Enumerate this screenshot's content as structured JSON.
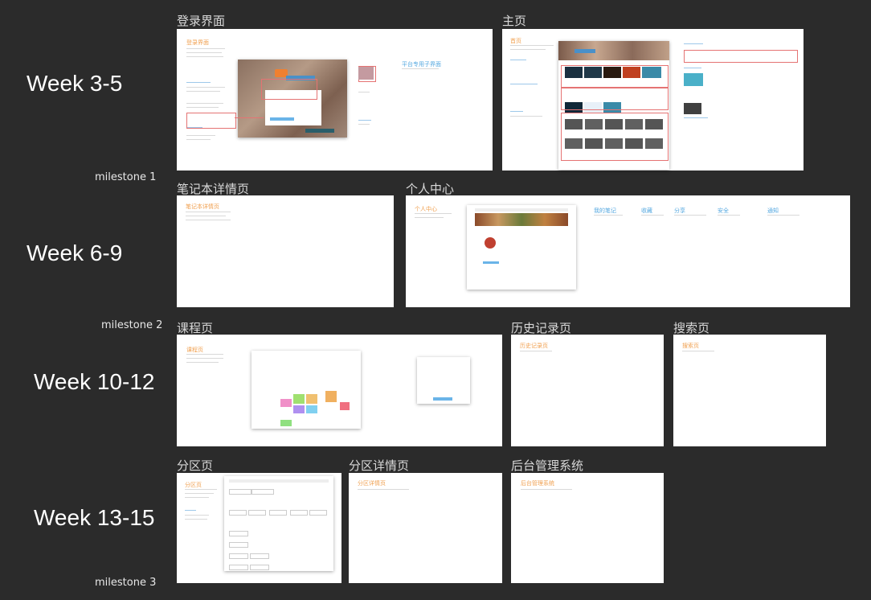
{
  "weeks": [
    {
      "label": "Week 3-5"
    },
    {
      "label": "Week 6-9"
    },
    {
      "label": "Week 10-12"
    },
    {
      "label": "Week 13-15"
    }
  ],
  "milestones": [
    "milestone 1",
    "milestone 2",
    "milestone 3"
  ],
  "frames": {
    "login": {
      "title": "登录界面",
      "heading": "登录界面",
      "side_heading": "平台专用子界面"
    },
    "home": {
      "title": "主页",
      "heading": "首页"
    },
    "notebook": {
      "title": "笔记本详情页",
      "heading": "笔记本详情页"
    },
    "personal": {
      "title": "个人中心",
      "heading": "个人中心",
      "tabs": [
        "我的笔记",
        "收藏",
        "分享",
        "安全",
        "通知"
      ]
    },
    "course": {
      "title": "课程页",
      "heading": "课程页"
    },
    "history": {
      "title": "历史记录页",
      "heading": "历史记录页"
    },
    "search": {
      "title": "搜索页",
      "heading": "搜索页"
    },
    "zone": {
      "title": "分区页",
      "heading": "分区页"
    },
    "zone_detail": {
      "title": "分区详情页",
      "heading": "分区详情页"
    },
    "admin": {
      "title": "后台管理系统",
      "heading": "后台管理系统"
    }
  },
  "colors": {
    "background": "#2b2b2b",
    "accent_orange": "#f0a050",
    "accent_blue": "#55a8e0",
    "annotation_red": "#e57373"
  }
}
